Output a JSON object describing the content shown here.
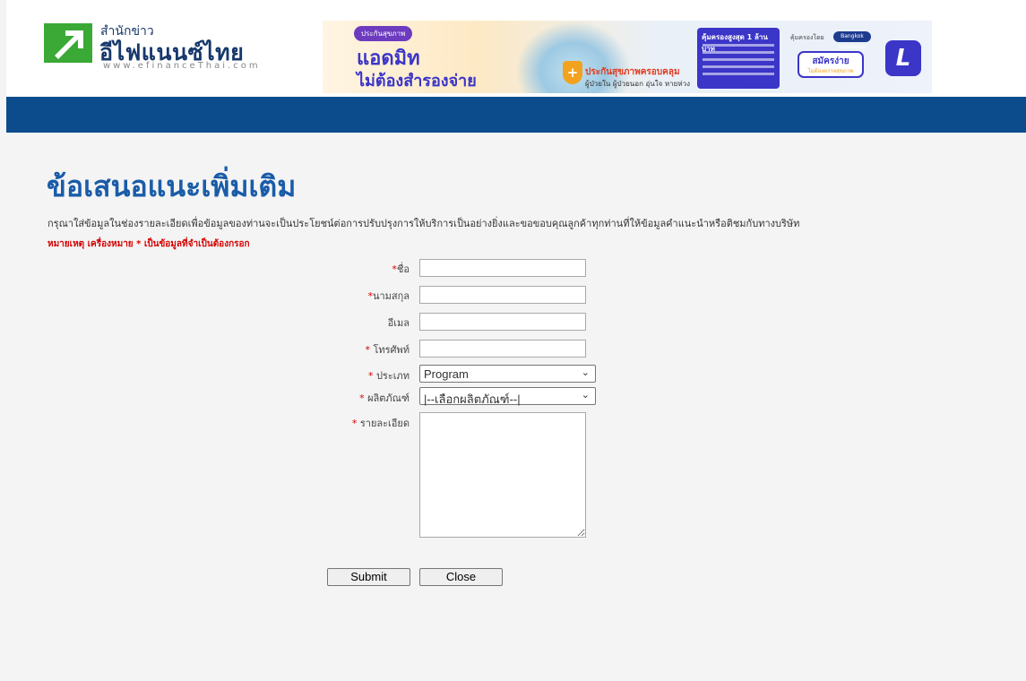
{
  "logo": {
    "small_text": "สำนักข่าว",
    "name": "อีไฟแนนซ์ไทย",
    "url": "www.efinanceThai.com"
  },
  "banner": {
    "chip": "ประกันสุขภาพ",
    "headline1": "แอดมิท",
    "headline2": "ไม่ต้องสำรองจ่าย",
    "sub1": "ประกันสุขภาพครอบคลุม",
    "sub2": "ผู้ป่วยใน ผู้ป่วยนอก อุ่นใจ หายห่วง",
    "box_title": "คุ้มครองสูงสุด 1 ล้านบาท",
    "tag": "คุ้มครองโดย",
    "insurer": "Bangkok Insurance",
    "button_line1": "สมัครง่าย",
    "button_line2": "ไม่ต้องตรวจสุขภาพ",
    "brand_logo": "L"
  },
  "page": {
    "title": "ข้อเสนอแนะเพิ่มเติม",
    "description": "กรุณาใส่ข้อมูลในช่องรายละเอียดเพื่อข้อมูลของท่านจะเป็นประโยชน์ต่อการปรับปรุงการให้บริการเป็นอย่างยิ่งและขอขอบคุณลูกค้าทุกท่านที่ให้ข้อมูลคำแนะนำหรือติชมกับทางบริษัท",
    "note": "หมายเหตุ เครื่องหมาย * เป็นข้อมูลที่จำเป็นต้องกรอก"
  },
  "form": {
    "required_mark": "*",
    "first_name_label": "ชื่อ",
    "last_name_label": "นามสกุล",
    "email_label": "อีเมล",
    "phone_label": "โทรศัพท์",
    "type_label": "ประเภท",
    "type_value": "Program",
    "product_label": "ผลิตภัณฑ์",
    "product_value": "|--เลือกผลิตภัณฑ์--|",
    "detail_label": "รายละเอียด",
    "first_name_value": "",
    "last_name_value": "",
    "email_value": "",
    "phone_value": "",
    "detail_value": "",
    "submit": "Submit",
    "close": "Close"
  }
}
